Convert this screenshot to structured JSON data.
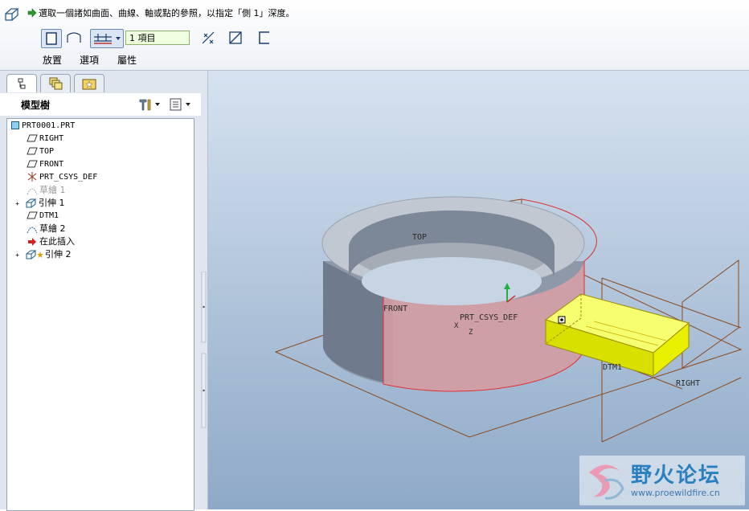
{
  "dashboard": {
    "prompt": "選取一個諸如曲面、曲線、軸或點的參照，以指定「側 1」深度。",
    "depth_value": "1 項目",
    "tabs": [
      "放置",
      "選項",
      "屬性"
    ]
  },
  "left_panel": {
    "tabs": [
      "model-tree",
      "layers",
      "favorites"
    ],
    "tree_title": "模型樹",
    "nodes": [
      {
        "label": "PRT0001.PRT",
        "icon": "part-icon"
      },
      {
        "label": "RIGHT",
        "icon": "datum-plane-icon"
      },
      {
        "label": "TOP",
        "icon": "datum-plane-icon"
      },
      {
        "label": "FRONT",
        "icon": "datum-plane-icon"
      },
      {
        "label": "PRT_CSYS_DEF",
        "icon": "csys-icon"
      },
      {
        "label": "草繪 1",
        "icon": "sketch-icon"
      },
      {
        "label": "引伸 1",
        "icon": "extrude-icon"
      },
      {
        "label": "DTM1",
        "icon": "datum-plane-icon"
      },
      {
        "label": "草繪 2",
        "icon": "sketch-icon"
      },
      {
        "label": "在此插入",
        "icon": "insert-here-icon"
      },
      {
        "label": "引伸 2",
        "icon": "extrude-icon"
      }
    ]
  },
  "viewport": {
    "labels": {
      "top": "TOP",
      "front": "FRONT",
      "csys": "PRT_CSYS_DEF",
      "dtm1": "DTM1",
      "right": "RIGHT",
      "axis_x": "X",
      "axis_z": "Z"
    },
    "watermark_title": "野火论坛",
    "watermark_url": "www.proewildfire.cn"
  },
  "colors": {
    "datum_line": "#8b4a1e",
    "preview_yellow": "#e8f000",
    "selection_red": "#e03030",
    "watermark_blue": "#2a7fbf"
  }
}
